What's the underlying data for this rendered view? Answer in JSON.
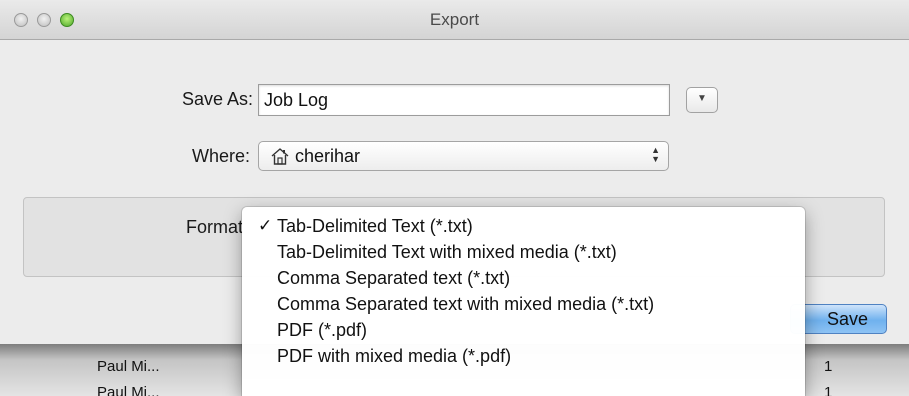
{
  "window": {
    "title": "Export"
  },
  "form": {
    "save_as_label": "Save As:",
    "save_as_value": "Job Log",
    "where_label": "Where:",
    "where_value": "cherihar",
    "format_label": "Format"
  },
  "icons": {
    "expand": "triangle-down-icon",
    "where": "home-icon",
    "stepper": "up-down-chevron-icon",
    "check": "checkmark-icon"
  },
  "format_menu": {
    "items": [
      {
        "label": "Tab-Delimited Text (*.txt)",
        "selected": true
      },
      {
        "label": "Tab-Delimited Text with mixed media (*.txt)",
        "selected": false
      },
      {
        "label": "Comma Separated text (*.txt)",
        "selected": false
      },
      {
        "label": "Comma Separated text with mixed media (*.txt)",
        "selected": false
      },
      {
        "label": "PDF (*.pdf)",
        "selected": false
      },
      {
        "label": "PDF with mixed media (*.pdf)",
        "selected": false
      }
    ],
    "check_glyph": "✓"
  },
  "buttons": {
    "save_label": "Save"
  },
  "background_table": {
    "rows": [
      {
        "name": "Paul Mi...",
        "count": "1"
      },
      {
        "name": "Paul Mi...",
        "count": "1"
      }
    ]
  },
  "colors": {
    "default_button": "#6fb1ee",
    "zoom_button": "#4fa82a"
  }
}
